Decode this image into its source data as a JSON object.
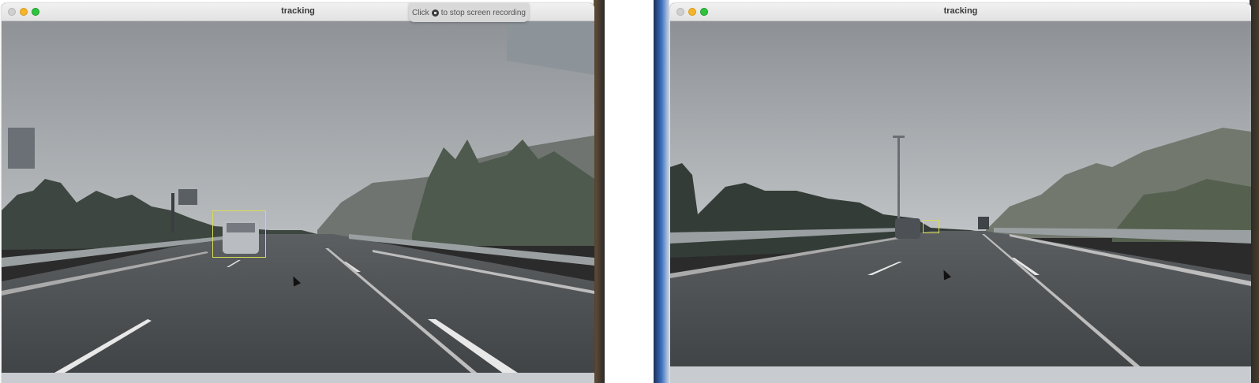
{
  "windows": [
    {
      "title": "tracking"
    },
    {
      "title": "tracking"
    }
  ],
  "recording_banner": {
    "prefix": "Click",
    "suffix": "to stop screen recording"
  }
}
